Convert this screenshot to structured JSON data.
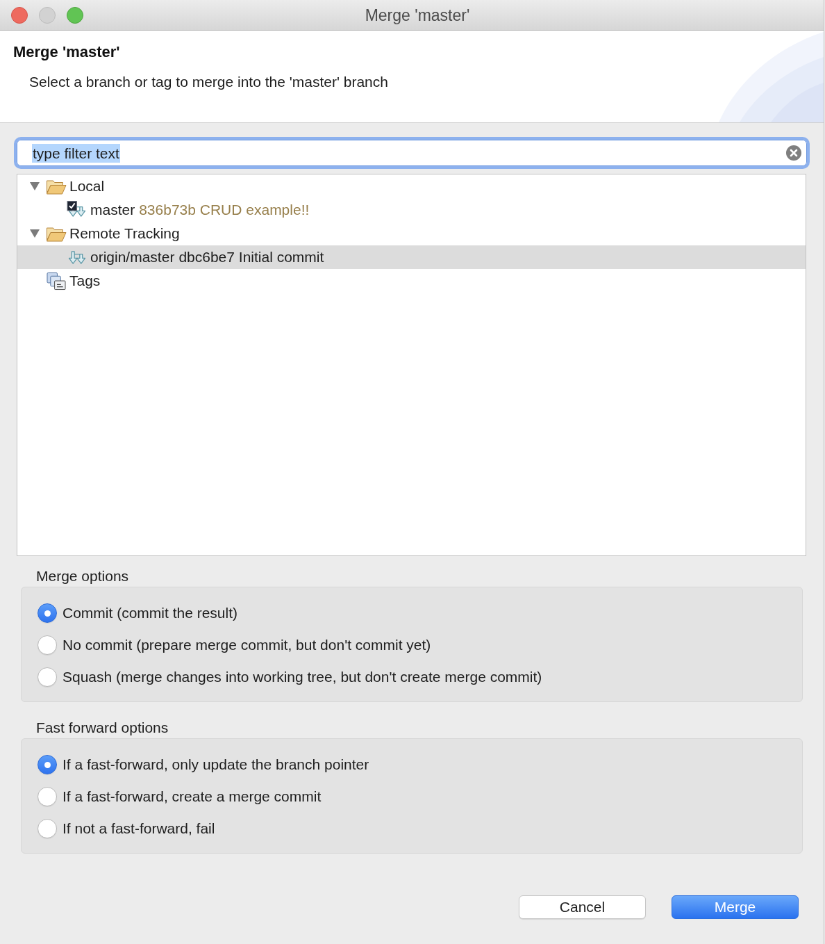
{
  "window": {
    "title": "Merge 'master'"
  },
  "header": {
    "title": "Merge 'master'",
    "description": "Select a branch or tag to merge into the 'master' branch"
  },
  "filter": {
    "value": "type filter text",
    "text_selected": true
  },
  "tree": {
    "items": [
      {
        "label": "Local",
        "kind": "folder",
        "expanded": true,
        "selected": false,
        "children": [
          {
            "label": "master",
            "commit": "836b73b CRUD example!!",
            "kind": "branch",
            "checked_out": true,
            "selected": false
          }
        ]
      },
      {
        "label": "Remote Tracking",
        "kind": "folder",
        "expanded": true,
        "selected": false,
        "children": [
          {
            "label": "origin/master",
            "commit": "dbc6be7 Initial commit",
            "kind": "branch",
            "checked_out": false,
            "selected": true
          }
        ]
      },
      {
        "label": "Tags",
        "kind": "tags",
        "selected": false
      }
    ]
  },
  "merge_options": {
    "title": "Merge options",
    "options": [
      {
        "label": "Commit (commit the result)",
        "selected": true
      },
      {
        "label": "No commit (prepare merge commit, but don't commit yet)",
        "selected": false
      },
      {
        "label": "Squash (merge changes into working tree, but don't create merge commit)",
        "selected": false
      }
    ]
  },
  "fast_forward_options": {
    "title": "Fast forward options",
    "options": [
      {
        "label": "If a fast-forward, only update the branch pointer",
        "selected": true
      },
      {
        "label": "If a fast-forward, create a merge commit",
        "selected": false
      },
      {
        "label": "If not a fast-forward, fail",
        "selected": false
      }
    ]
  },
  "buttons": [
    {
      "label": "Cancel",
      "kind": "cancel"
    },
    {
      "label": "Merge",
      "kind": "default"
    }
  ]
}
